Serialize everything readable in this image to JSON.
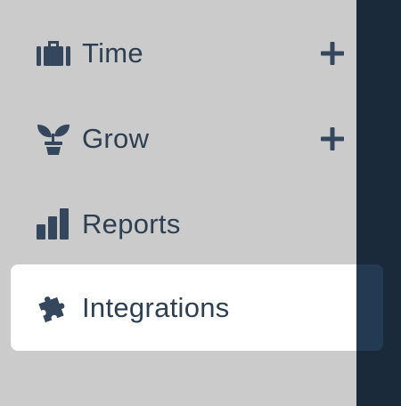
{
  "nav": {
    "items": [
      {
        "label": "Time",
        "icon": "briefcase-icon",
        "expandable": true
      },
      {
        "label": "Grow",
        "icon": "plant-icon",
        "expandable": true
      },
      {
        "label": "Reports",
        "icon": "bar-chart-icon",
        "expandable": false
      },
      {
        "label": "Integrations",
        "icon": "puzzle-icon",
        "expandable": false,
        "active": true
      }
    ]
  },
  "colors": {
    "background": "#cbcbcb",
    "dark_panel": "#1b2a3a",
    "icon": "#34475c",
    "active_background": "#ffffff"
  }
}
